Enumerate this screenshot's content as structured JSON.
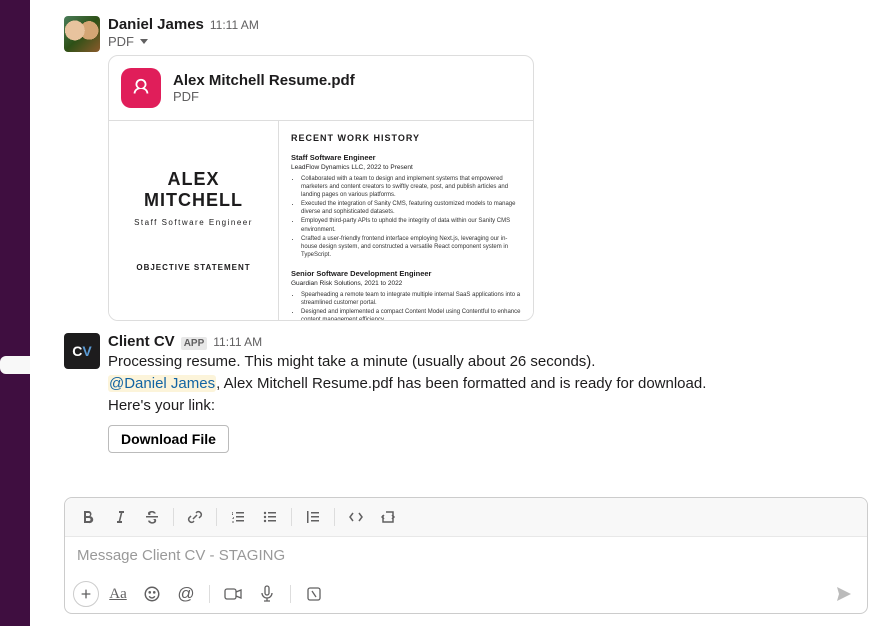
{
  "messages": [
    {
      "author": "Daniel James",
      "ts": "11:11 AM",
      "file_sub": "PDF",
      "file": {
        "name": "Alex Mitchell Resume.pdf",
        "type": "PDF",
        "preview": {
          "name_line1": "ALEX",
          "name_line2": "MITCHELL",
          "title": "Staff Software Engineer",
          "objective_label": "OBJECTIVE STATEMENT",
          "section_title": "RECENT WORK HISTORY",
          "job1_title": "Staff Software Engineer",
          "job1_sub": "LeadFlow Dynamics LLC, 2022 to Present",
          "job1_bullets": [
            "Collaborated with a team to design and implement systems that empowered marketers and content creators to swiftly create, post, and publish articles and landing pages on various platforms.",
            "Executed the integration of Sanity CMS, featuring customized models to manage diverse and sophisticated datasets.",
            "Employed third-party APIs to uphold the integrity of data within our Sanity CMS environment.",
            "Crafted a user-friendly frontend interface employing Next.js, leveraging our in-house design system, and constructed a versatile React component system in TypeScript."
          ],
          "job2_title": "Senior Software Development Engineer",
          "job2_sub": "Guardian Risk Solutions, 2021 to 2022",
          "job2_bullets": [
            "Spearheading a remote team to integrate multiple internal SaaS applications into a streamlined customer portal.",
            "Designed and implemented a compact Content Model using Contentful to enhance content management efficiency."
          ]
        }
      }
    },
    {
      "author": "Client CV",
      "is_app": true,
      "app_label": "APP",
      "ts": "11:11 AM",
      "line1": "Processing resume. This might take a minute (usually about 26 seconds).",
      "mention": "@Daniel James",
      "line2_after": ", Alex Mitchell Resume.pdf has been formatted and is ready for download.",
      "line3": "Here's your link:",
      "button": "Download File"
    }
  ],
  "avatar_app_logo": {
    "c": "C",
    "v": "V"
  },
  "composer": {
    "placeholder": "Message Client CV - STAGING"
  }
}
